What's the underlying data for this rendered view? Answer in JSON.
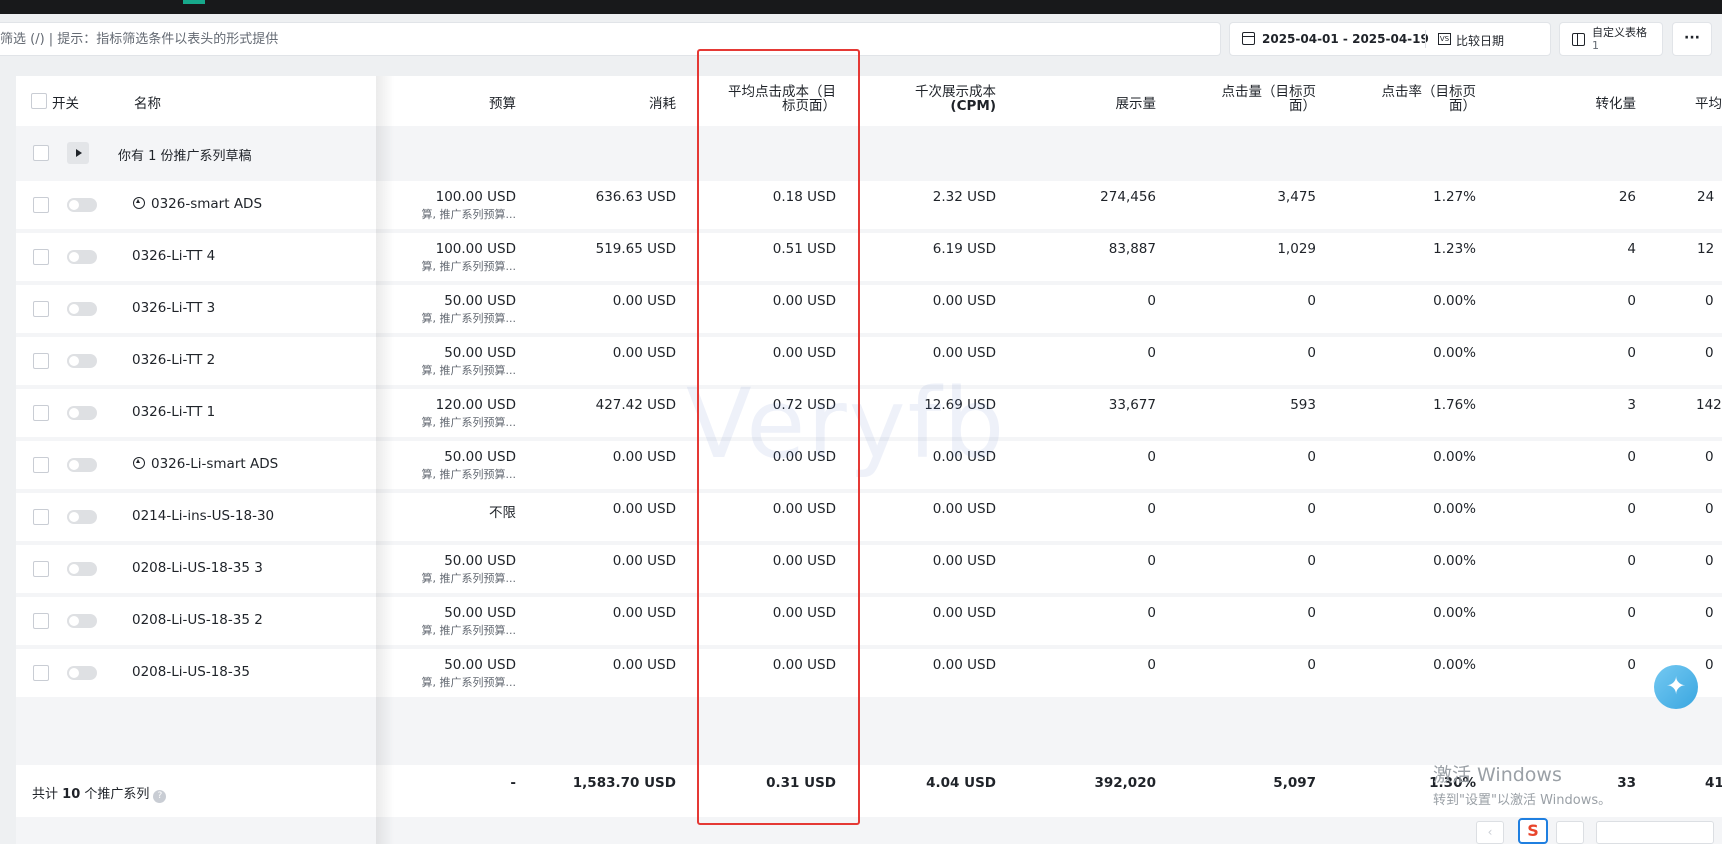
{
  "filter": {
    "placeholder": "筛选 (/) | 提示：指标筛选条件以表头的形式提供"
  },
  "date_range": {
    "value": "2025-04-01 - 2025-04-19",
    "compare_label": "比较日期"
  },
  "toolbar": {
    "custom_table_label": "自定义表格",
    "custom_table_count": "1",
    "more_label": "···"
  },
  "table": {
    "headers": {
      "toggle": "开关",
      "name": "名称",
      "budget": "预算",
      "spend": "消耗",
      "cpc_line1": "平均点击成本（目",
      "cpc_line2": "标页面）",
      "cpm_line1": "千次展示成本",
      "cpm_line2": "(CPM)",
      "impressions": "展示量",
      "clicks_line1": "点击量（目标页",
      "clicks_line2": "面）",
      "ctr_line1": "点击率（目标页",
      "ctr_line2": "面）",
      "conversions": "转化量",
      "avg_partial": "平均"
    },
    "draft_text": "你有 1 份推广系列草稿",
    "rows": [
      {
        "name": "0326-smart ADS",
        "smart": true,
        "budget": "100.00 USD",
        "budget_note": "算, 推广系列预算...",
        "spend": "636.63 USD",
        "cpc": "0.18 USD",
        "cpm": "2.32 USD",
        "impressions": "274,456",
        "clicks": "3,475",
        "ctr": "1.27%",
        "conversions": "26",
        "avg": "24"
      },
      {
        "name": "0326-Li-TT 4",
        "smart": false,
        "budget": "100.00 USD",
        "budget_note": "算, 推广系列预算...",
        "spend": "519.65 USD",
        "cpc": "0.51 USD",
        "cpm": "6.19 USD",
        "impressions": "83,887",
        "clicks": "1,029",
        "ctr": "1.23%",
        "conversions": "4",
        "avg": "12"
      },
      {
        "name": "0326-Li-TT 3",
        "smart": false,
        "budget": "50.00 USD",
        "budget_note": "算, 推广系列预算...",
        "spend": "0.00 USD",
        "cpc": "0.00 USD",
        "cpm": "0.00 USD",
        "impressions": "0",
        "clicks": "0",
        "ctr": "0.00%",
        "conversions": "0",
        "avg": "0"
      },
      {
        "name": "0326-Li-TT 2",
        "smart": false,
        "budget": "50.00 USD",
        "budget_note": "算, 推广系列预算...",
        "spend": "0.00 USD",
        "cpc": "0.00 USD",
        "cpm": "0.00 USD",
        "impressions": "0",
        "clicks": "0",
        "ctr": "0.00%",
        "conversions": "0",
        "avg": "0"
      },
      {
        "name": "0326-Li-TT 1",
        "smart": false,
        "budget": "120.00 USD",
        "budget_note": "算, 推广系列预算...",
        "spend": "427.42 USD",
        "cpc": "0.72 USD",
        "cpm": "12.69 USD",
        "impressions": "33,677",
        "clicks": "593",
        "ctr": "1.76%",
        "conversions": "3",
        "avg": "142"
      },
      {
        "name": "0326-Li-smart ADS",
        "smart": true,
        "budget": "50.00 USD",
        "budget_note": "算, 推广系列预算...",
        "spend": "0.00 USD",
        "cpc": "0.00 USD",
        "cpm": "0.00 USD",
        "impressions": "0",
        "clicks": "0",
        "ctr": "0.00%",
        "conversions": "0",
        "avg": "0"
      },
      {
        "name": "0214-Li-ins-US-18-30",
        "smart": false,
        "budget": "不限",
        "budget_note": "",
        "spend": "0.00 USD",
        "cpc": "0.00 USD",
        "cpm": "0.00 USD",
        "impressions": "0",
        "clicks": "0",
        "ctr": "0.00%",
        "conversions": "0",
        "avg": "0"
      },
      {
        "name": "0208-Li-US-18-35 3",
        "smart": false,
        "budget": "50.00 USD",
        "budget_note": "算, 推广系列预算...",
        "spend": "0.00 USD",
        "cpc": "0.00 USD",
        "cpm": "0.00 USD",
        "impressions": "0",
        "clicks": "0",
        "ctr": "0.00%",
        "conversions": "0",
        "avg": "0"
      },
      {
        "name": "0208-Li-US-18-35 2",
        "smart": false,
        "budget": "50.00 USD",
        "budget_note": "算, 推广系列预算...",
        "spend": "0.00 USD",
        "cpc": "0.00 USD",
        "cpm": "0.00 USD",
        "impressions": "0",
        "clicks": "0",
        "ctr": "0.00%",
        "conversions": "0",
        "avg": "0"
      },
      {
        "name": "0208-Li-US-18-35",
        "smart": false,
        "budget": "50.00 USD",
        "budget_note": "算, 推广系列预算...",
        "spend": "0.00 USD",
        "cpc": "0.00 USD",
        "cpm": "0.00 USD",
        "impressions": "0",
        "clicks": "0",
        "ctr": "0.00%",
        "conversions": "0",
        "avg": "0"
      }
    ],
    "total": {
      "label_prefix": "共计",
      "count": "10",
      "label_suffix": "个推广系列",
      "budget": "-",
      "spend": "1,583.70 USD",
      "cpc": "0.31 USD",
      "cpm": "4.04 USD",
      "impressions": "392,020",
      "clicks": "5,097",
      "ctr": "1.30%",
      "conversions": "33",
      "avg": "41"
    }
  },
  "watermark": "Veryfb",
  "windows_activation": {
    "line1": "激活 Windows",
    "line2": "转到\"设置\"以激活 Windows。"
  },
  "pagination": {
    "prev_symbol": "‹",
    "logo_text": "S"
  },
  "colors": {
    "highlight_box": "#e53935",
    "topbar": "#18191b",
    "accent": "#17a88b"
  }
}
